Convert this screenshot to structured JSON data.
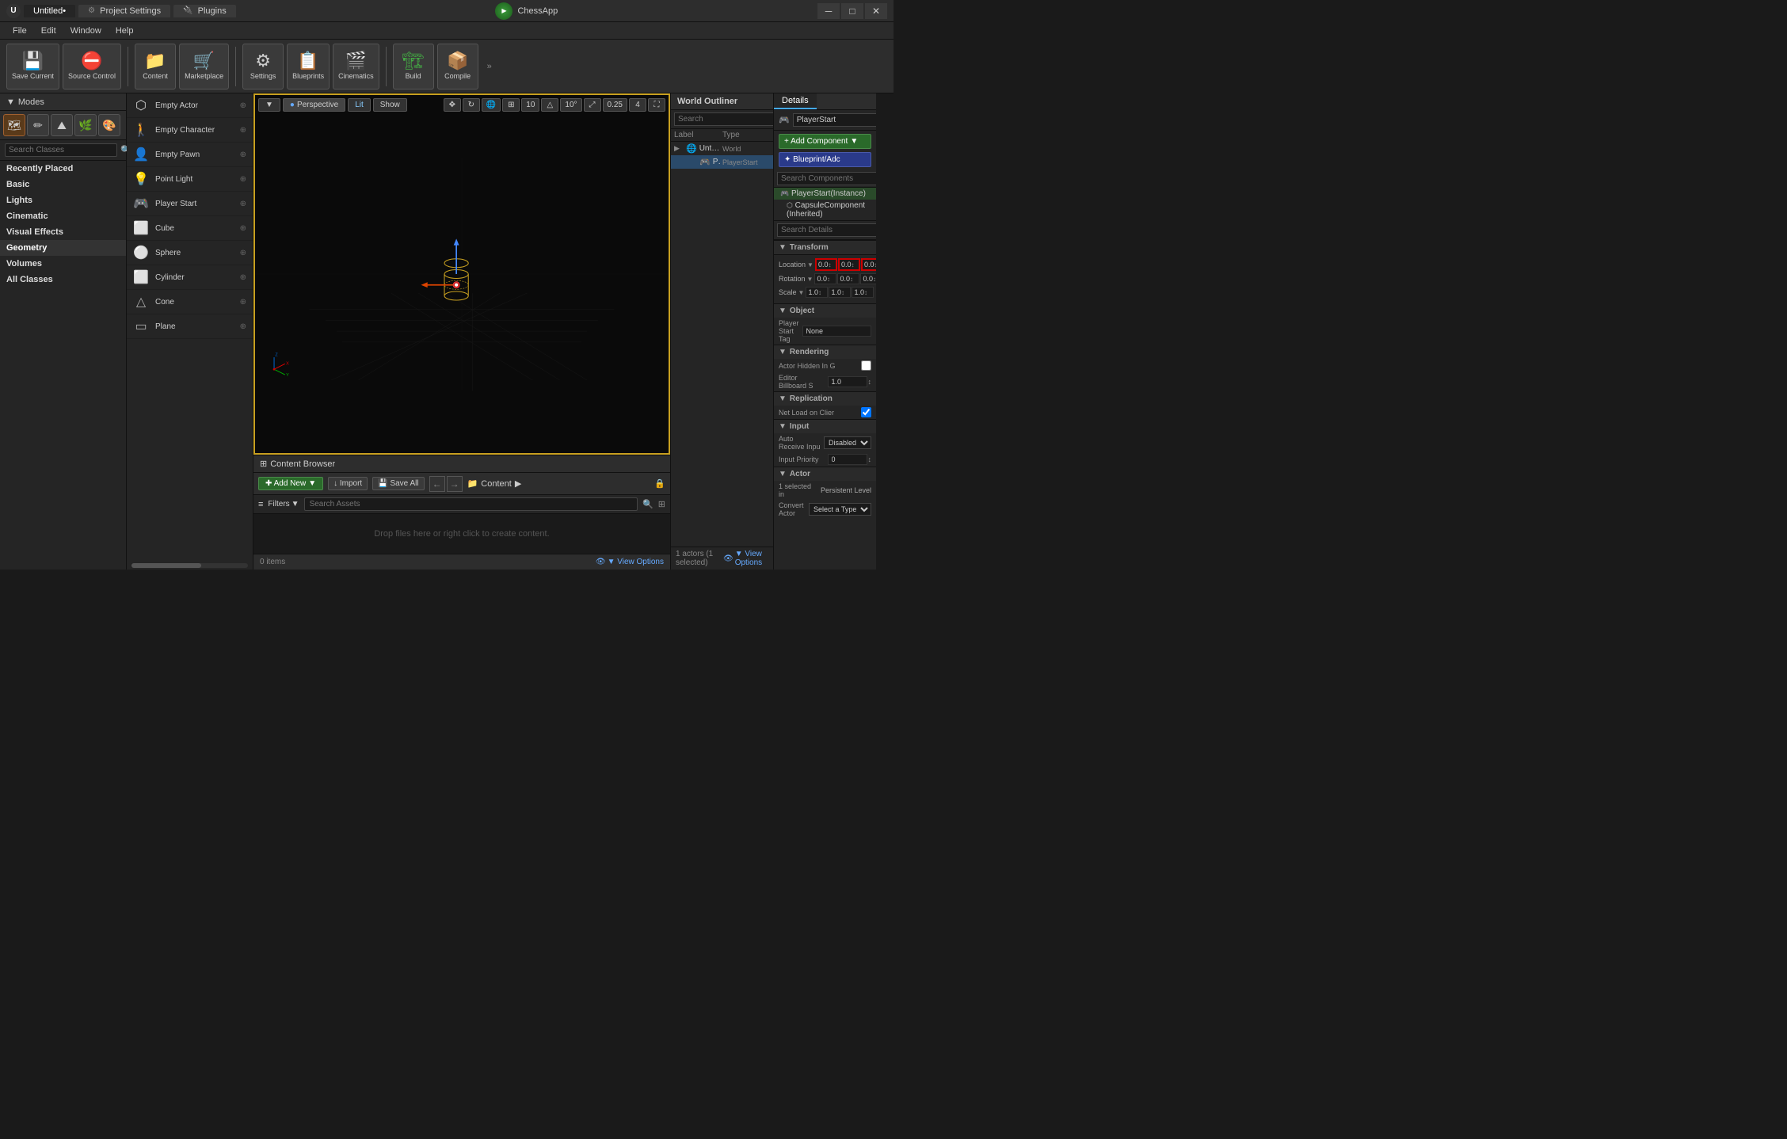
{
  "titlebar": {
    "logo": "U",
    "tabs": [
      {
        "label": "Untitled•",
        "active": true
      },
      {
        "label": "Project Settings",
        "active": false,
        "icon": "⚙"
      },
      {
        "label": "Plugins",
        "active": false,
        "icon": "🔌"
      }
    ],
    "app_name": "ChessApp",
    "controls": [
      "─",
      "□",
      "✕"
    ]
  },
  "menubar": {
    "items": [
      "File",
      "Edit",
      "Window",
      "Help"
    ]
  },
  "toolbar": {
    "buttons": [
      {
        "label": "Save Current",
        "icon": "💾",
        "icon_class": "toolbar-icon-blue"
      },
      {
        "label": "Source Control",
        "icon": "⛔",
        "icon_class": "toolbar-icon-red"
      },
      {
        "label": "Content",
        "icon": "📁",
        "icon_class": "toolbar-icon-blue"
      },
      {
        "label": "Marketplace",
        "icon": "🛒",
        "icon_class": "toolbar-icon-blue"
      },
      {
        "label": "Settings",
        "icon": "⚙",
        "icon_class": ""
      },
      {
        "label": "Blueprints",
        "icon": "📋",
        "icon_class": "toolbar-icon-blue"
      },
      {
        "label": "Cinematics",
        "icon": "🎬",
        "icon_class": "toolbar-icon-orange"
      },
      {
        "label": "Build",
        "icon": "🏗",
        "icon_class": "toolbar-icon-green"
      },
      {
        "label": "Compile",
        "icon": "📦",
        "icon_class": "toolbar-icon-blue"
      }
    ]
  },
  "modes": {
    "header": "Modes",
    "icons": [
      "🗺",
      "✏",
      "⛰",
      "🌿",
      "🎨"
    ]
  },
  "search_classes": {
    "placeholder": "Search Classes"
  },
  "categories": [
    {
      "label": "Recently Placed",
      "active": false
    },
    {
      "label": "Basic",
      "active": false
    },
    {
      "label": "Lights",
      "active": false
    },
    {
      "label": "Cinematic",
      "active": false
    },
    {
      "label": "Visual Effects",
      "active": false
    },
    {
      "label": "Geometry",
      "active": true
    },
    {
      "label": "Volumes",
      "active": false
    },
    {
      "label": "All Classes",
      "active": false
    }
  ],
  "place_items": [
    {
      "name": "Empty Actor",
      "icon": "⬡"
    },
    {
      "name": "Empty Character",
      "icon": "🚶"
    },
    {
      "name": "Empty Pawn",
      "icon": "👤"
    },
    {
      "name": "Point Light",
      "icon": "💡"
    },
    {
      "name": "Player Start",
      "icon": "🎮"
    },
    {
      "name": "Cube",
      "icon": "⬜"
    },
    {
      "name": "Sphere",
      "icon": "⚪"
    },
    {
      "name": "Cylinder",
      "icon": "⬜"
    },
    {
      "name": "Cone",
      "icon": "△"
    },
    {
      "name": "Plane",
      "icon": "▭"
    }
  ],
  "viewport": {
    "mode": "Perspective",
    "lit_label": "Lit",
    "show_label": "Show",
    "grid_val": "10",
    "angle_val": "10°",
    "scale_val": "0.25",
    "camera_val": "4",
    "arrow": "▼"
  },
  "world_outliner": {
    "title": "World Outliner",
    "search_placeholder": "Search",
    "col_label": "Label",
    "col_type": "Type",
    "items": [
      {
        "name": "Untitled (Editor)",
        "type": "World",
        "indent": 0,
        "expand": "▶"
      },
      {
        "name": "PlayerStart",
        "type": "PlayerStart",
        "indent": 1,
        "expand": "",
        "selected": true
      }
    ],
    "actors_info": "1 actors (1 selected)",
    "view_options": "▼ View Options"
  },
  "details": {
    "tab_label": "Details",
    "actor_name": "PlayerStart",
    "add_component_label": "+ Add Component",
    "blueprint_label": "✦ Blueprint/Adc",
    "search_components_placeholder": "Search Components",
    "components": [
      {
        "name": "PlayerStart(Instance)",
        "indent": 0,
        "selected": true
      },
      {
        "name": "CapsuleComponent (Inherited)",
        "indent": 1
      }
    ],
    "search_details_placeholder": "Search Details",
    "transform": {
      "label": "Transform",
      "location_label": "Location",
      "location_x": "0.0",
      "location_y": "0.0",
      "location_z": "0.0",
      "rotation_label": "Rotation",
      "rotation_x": "0.0",
      "rotation_y": "0.0",
      "rotation_z": "0.0",
      "scale_label": "Scale",
      "scale_x": "1.0",
      "scale_y": "1.0",
      "scale_z": "1.0"
    },
    "sections": [
      {
        "label": "Object",
        "properties": [
          {
            "label": "Player Start Tag",
            "value": "None"
          }
        ]
      },
      {
        "label": "Rendering",
        "properties": [
          {
            "label": "Actor Hidden In G",
            "value": "checkbox"
          },
          {
            "label": "Editor Billboard S",
            "value": "1.0"
          }
        ]
      },
      {
        "label": "Replication",
        "properties": [
          {
            "label": "Net Load on Clier",
            "value": "checkbox_checked"
          }
        ]
      },
      {
        "label": "Input",
        "properties": [
          {
            "label": "Auto Receive Inpu",
            "value": "Disabled"
          },
          {
            "label": "Input Priority",
            "value": "0"
          }
        ]
      },
      {
        "label": "Actor",
        "properties": [
          {
            "label": "1 selected in",
            "value": "Persistent Level"
          },
          {
            "label": "Convert Actor",
            "value": "Select a Type"
          }
        ]
      }
    ]
  },
  "content_browser": {
    "title": "Content Browser",
    "add_new_label": "✚ Add New",
    "import_label": "↓ Import",
    "save_all_label": "💾 Save All",
    "nav_back": "←",
    "nav_fwd": "→",
    "path_icon": "📁",
    "path_label": "Content",
    "path_arrow": "▶",
    "filters_label": "Filters",
    "filters_arrow": "▼",
    "search_placeholder": "Search Assets",
    "drop_text": "Drop files here or right click to create content.",
    "items_count": "0 items",
    "view_options": "▼ View Options"
  }
}
